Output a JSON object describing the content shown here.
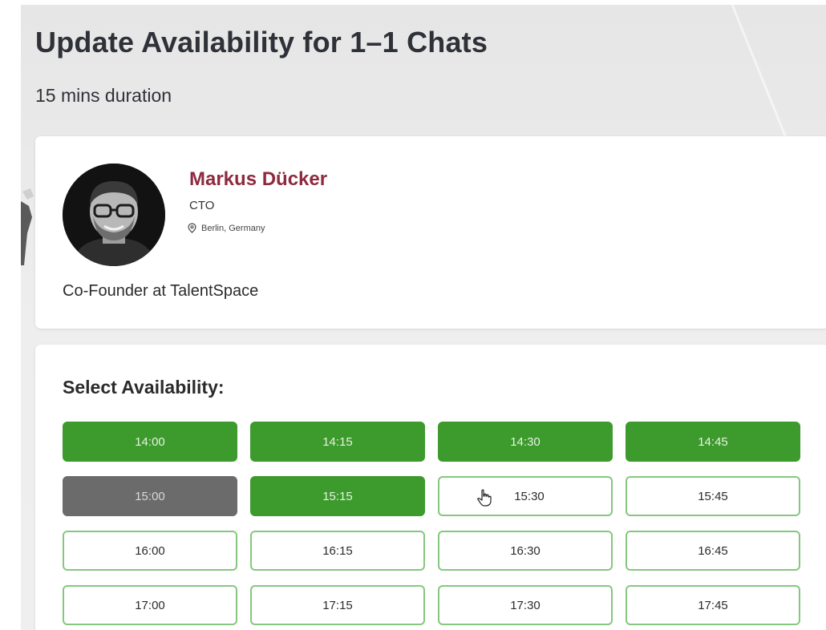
{
  "header": {
    "title": "Update Availability for 1–1 Chats",
    "duration": "15 mins duration"
  },
  "profile": {
    "name": "Markus Dücker",
    "role": "CTO",
    "location": "Berlin, Germany",
    "location_icon": "map-pin-icon",
    "bio": "Co-Founder at TalentSpace",
    "name_color": "#8e2a3d"
  },
  "availability": {
    "heading": "Select Availability:",
    "colors": {
      "selected": "#3d9a2c",
      "disabled": "#6b6b6b",
      "available_border": "#86c77f"
    },
    "slots": [
      {
        "time": "14:00",
        "state": "selected"
      },
      {
        "time": "14:15",
        "state": "selected"
      },
      {
        "time": "14:30",
        "state": "selected"
      },
      {
        "time": "14:45",
        "state": "selected"
      },
      {
        "time": "15:00",
        "state": "disabled"
      },
      {
        "time": "15:15",
        "state": "selected"
      },
      {
        "time": "15:30",
        "state": "available"
      },
      {
        "time": "15:45",
        "state": "available"
      },
      {
        "time": "16:00",
        "state": "available"
      },
      {
        "time": "16:15",
        "state": "available"
      },
      {
        "time": "16:30",
        "state": "available"
      },
      {
        "time": "16:45",
        "state": "available"
      },
      {
        "time": "17:00",
        "state": "available"
      },
      {
        "time": "17:15",
        "state": "available"
      },
      {
        "time": "17:30",
        "state": "available"
      },
      {
        "time": "17:45",
        "state": "available"
      }
    ]
  }
}
